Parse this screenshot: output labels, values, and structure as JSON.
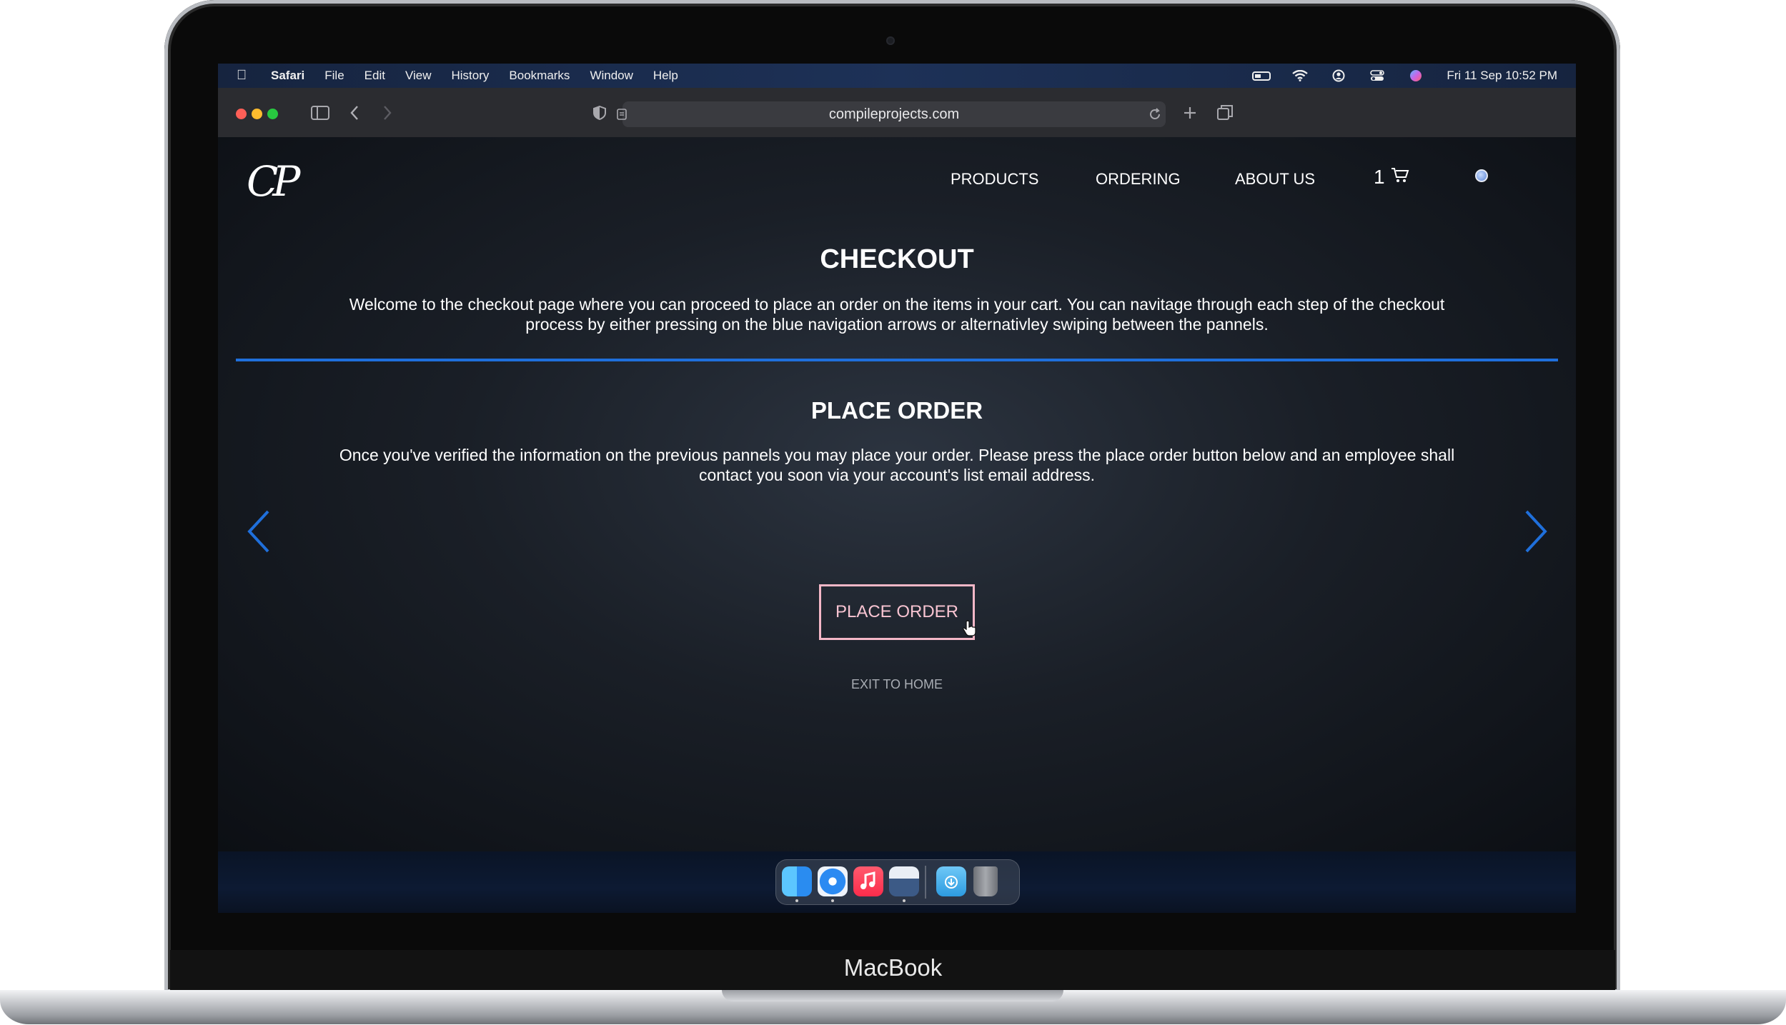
{
  "device": {
    "brand": "MacBook"
  },
  "menubar": {
    "app": "Safari",
    "items": [
      "File",
      "Edit",
      "View",
      "History",
      "Bookmarks",
      "Window",
      "Help"
    ],
    "datetime": "Fri 11 Sep  10:52 PM"
  },
  "browser": {
    "url": "compileprojects.com"
  },
  "site": {
    "logo_text": "CP",
    "nav": {
      "products": "PRODUCTS",
      "ordering": "ORDERING",
      "about": "ABOUT US"
    },
    "cart_count": "1"
  },
  "checkout": {
    "title": "CHECKOUT",
    "intro": "Welcome to the checkout page where you can proceed to place an order on the items in your cart. You can navitage through each step of the checkout process by either pressing on the blue navigation arrows or alternativley swiping between the pannels.",
    "panel_title": "PLACE ORDER",
    "panel_text": "Once you've verified the information on the previous pannels you may place your order. Please press the place order button below and an employee shall contact you soon via your account's list email address.",
    "place_order_label": "PLACE ORDER",
    "exit_label": "EXIT TO HOME"
  },
  "colors": {
    "accent_blue": "#1f6fdb",
    "button_pink": "#f4b7c7"
  },
  "dock": {
    "apps": [
      "finder-icon",
      "safari-icon",
      "music-icon",
      "preview-icon",
      "downloads-icon",
      "trash-icon"
    ]
  }
}
